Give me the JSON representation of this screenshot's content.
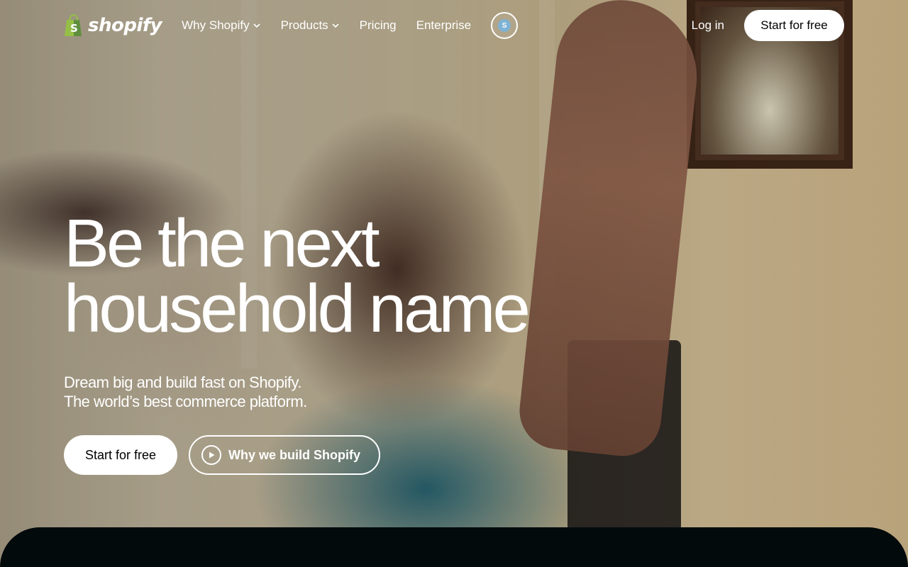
{
  "brand": {
    "name": "shopify",
    "accent": "#95bf47"
  },
  "nav": {
    "items": [
      {
        "label": "Why Shopify",
        "has_dropdown": true
      },
      {
        "label": "Products",
        "has_dropdown": true
      },
      {
        "label": "Pricing",
        "has_dropdown": false
      },
      {
        "label": "Enterprise",
        "has_dropdown": false
      }
    ],
    "login_label": "Log in",
    "cta_label": "Start for free"
  },
  "hero": {
    "headline_line1": "Be the next",
    "headline_line2": "household name",
    "subhead_line1": "Dream big and build fast on Shopify.",
    "subhead_line2": "The world’s best commerce platform.",
    "primary_cta": "Start for free",
    "secondary_cta": "Why we build Shopify"
  },
  "icons": {
    "chevron": "chevron-down-icon",
    "play": "play-icon",
    "shop_app": "shop-app-icon"
  }
}
